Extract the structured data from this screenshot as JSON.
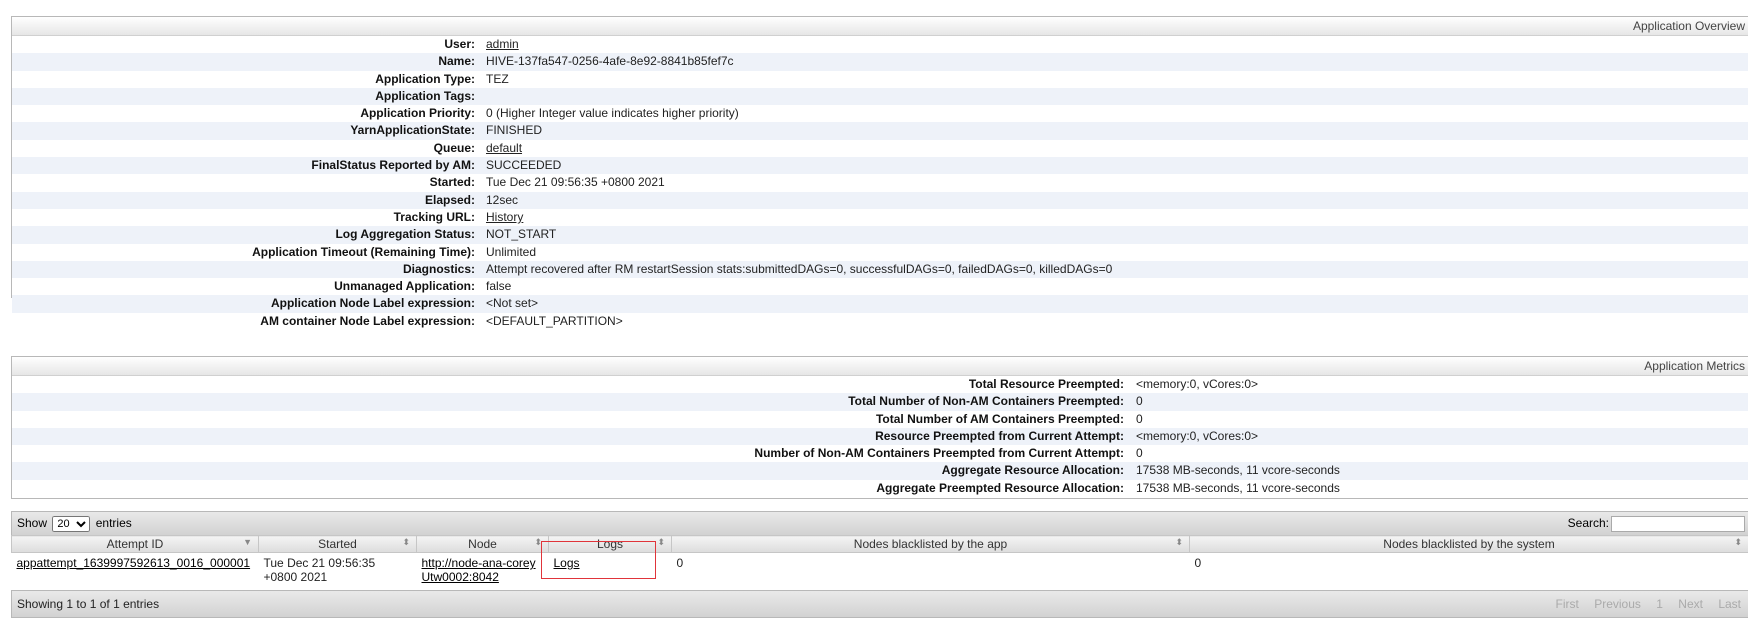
{
  "overview": {
    "title": "Application Overview",
    "rows": [
      {
        "key": "User:",
        "value": "admin",
        "link": true
      },
      {
        "key": "Name:",
        "value": "HIVE-137fa547-0256-4afe-8e92-8841b85fef7c"
      },
      {
        "key": "Application Type:",
        "value": "TEZ"
      },
      {
        "key": "Application Tags:",
        "value": ""
      },
      {
        "key": "Application Priority:",
        "value": "0 (Higher Integer value indicates higher priority)"
      },
      {
        "key": "YarnApplicationState:",
        "value": "FINISHED"
      },
      {
        "key": "Queue:",
        "value": "default",
        "link": true
      },
      {
        "key": "FinalStatus Reported by AM:",
        "value": "SUCCEEDED"
      },
      {
        "key": "Started:",
        "value": "Tue Dec 21 09:56:35 +0800 2021"
      },
      {
        "key": "Elapsed:",
        "value": "12sec"
      },
      {
        "key": "Tracking URL:",
        "value": "History",
        "link": true
      },
      {
        "key": "Log Aggregation Status:",
        "value": "NOT_START"
      },
      {
        "key": "Application Timeout (Remaining Time):",
        "value": "Unlimited"
      },
      {
        "key": "Diagnostics:",
        "value": "Attempt recovered after RM restartSession stats:submittedDAGs=0, successfulDAGs=0, failedDAGs=0, killedDAGs=0"
      },
      {
        "key": "Unmanaged Application:",
        "value": "false"
      },
      {
        "key": "Application Node Label expression:",
        "value": "<Not set>"
      },
      {
        "key": "AM container Node Label expression:",
        "value": "<DEFAULT_PARTITION>"
      }
    ]
  },
  "metrics": {
    "title": "Application Metrics",
    "rows": [
      {
        "key": "Total Resource Preempted:",
        "value": "<memory:0, vCores:0>"
      },
      {
        "key": "Total Number of Non-AM Containers Preempted:",
        "value": "0"
      },
      {
        "key": "Total Number of AM Containers Preempted:",
        "value": "0"
      },
      {
        "key": "Resource Preempted from Current Attempt:",
        "value": "<memory:0, vCores:0>"
      },
      {
        "key": "Number of Non-AM Containers Preempted from Current Attempt:",
        "value": "0"
      },
      {
        "key": "Aggregate Resource Allocation:",
        "value": "17538 MB-seconds, 11 vcore-seconds"
      },
      {
        "key": "Aggregate Preempted Resource Allocation:",
        "value": "17538 MB-seconds, 11 vcore-seconds"
      }
    ]
  },
  "attempts": {
    "show_label": "Show",
    "page_size": "20",
    "entries_label": "entries",
    "search_label": "Search:",
    "columns": [
      "Attempt ID",
      "Started",
      "Node",
      "Logs",
      "Nodes blacklisted by the app",
      "Nodes blacklisted by the system"
    ],
    "row": {
      "attempt_id": "appattempt_1639997592613_0016_000001",
      "started": "Tue Dec 21 09:56:35 +0800 2021",
      "node": "http://node-ana-coreyUtw0002:8042",
      "logs": "Logs",
      "blacklisted_app": "0",
      "blacklisted_system": "0"
    },
    "info": "Showing 1 to 1 of 1 entries",
    "pager": {
      "first": "First",
      "previous": "Previous",
      "page": "1",
      "next": "Next",
      "last": "Last"
    }
  }
}
